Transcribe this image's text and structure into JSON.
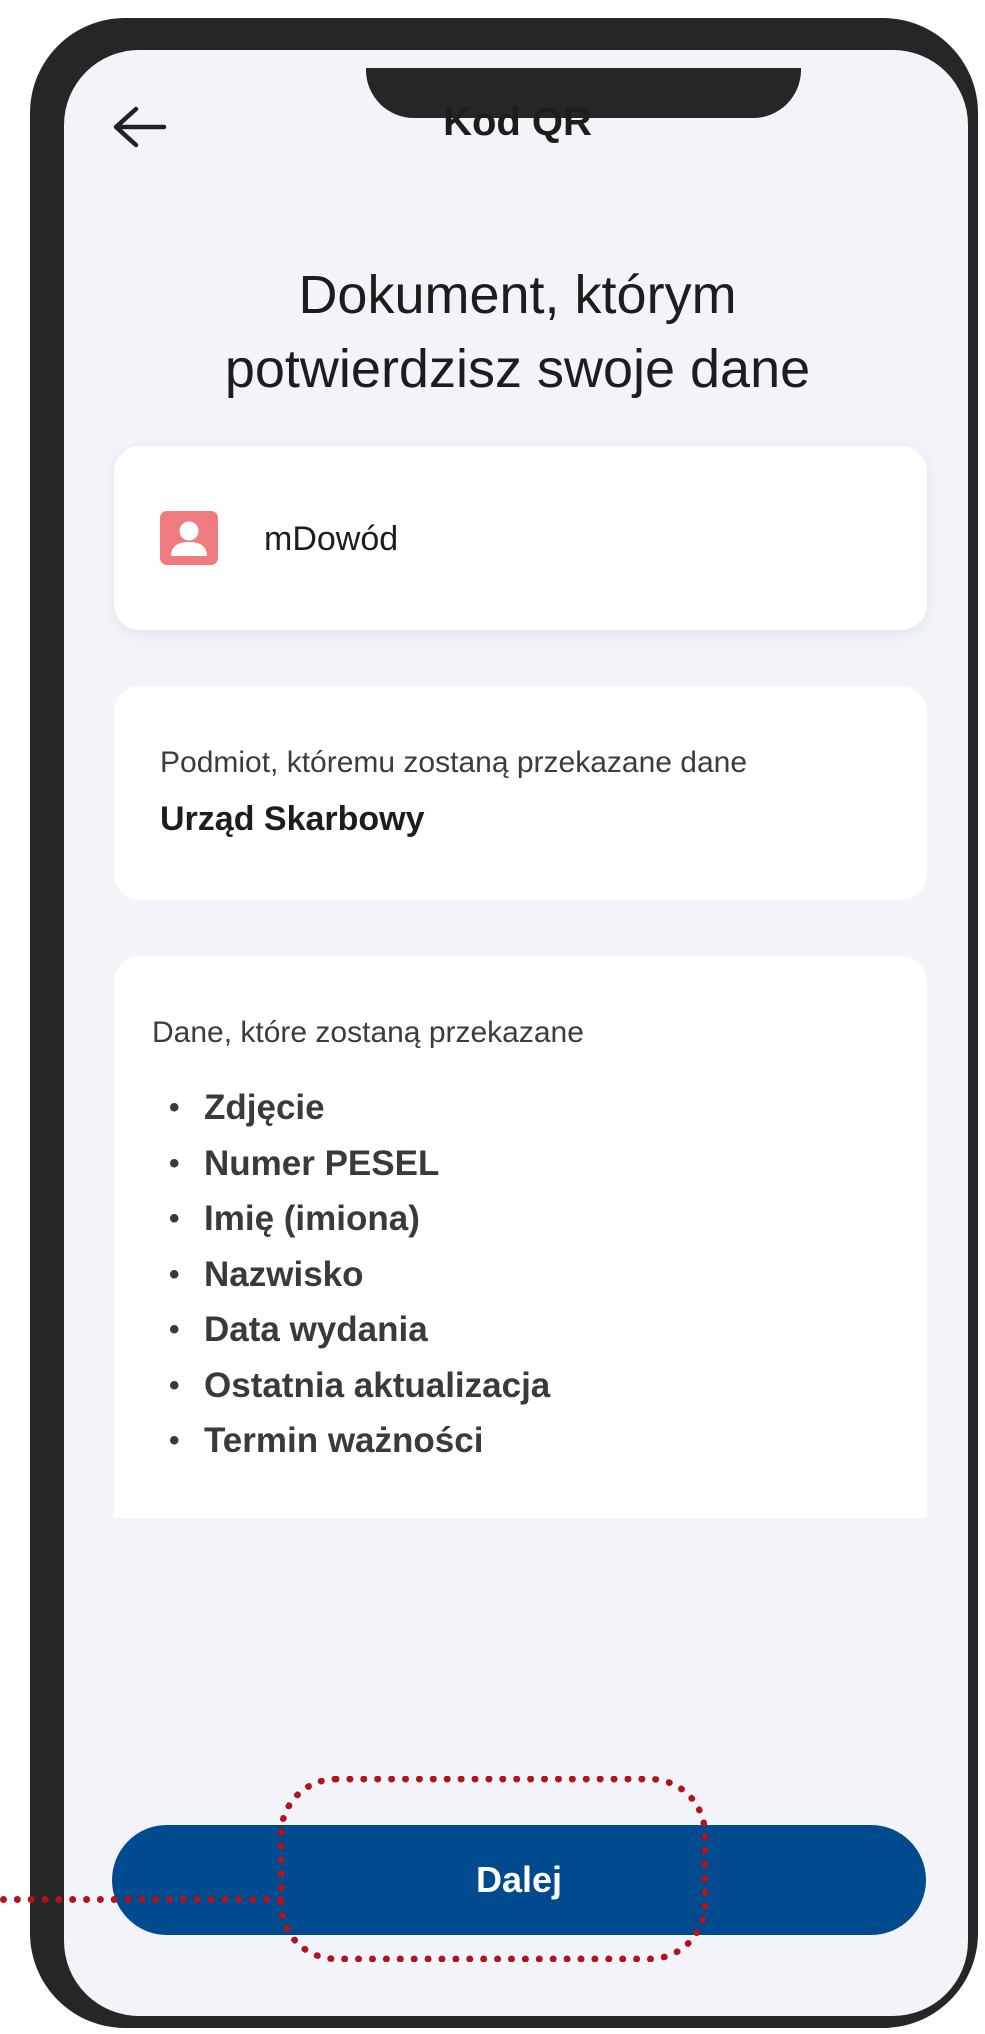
{
  "header": {
    "title": "Kod QR",
    "back_icon": "arrow-left-icon"
  },
  "heading": {
    "line1": "Dokument, którym",
    "line2": "potwierdzisz swoje dane"
  },
  "document_card": {
    "icon": "person-id-icon",
    "label": "mDowód",
    "icon_color": "#ef7a7f"
  },
  "entity_card": {
    "caption": "Podmiot, któremu zostaną przekazane dane",
    "name": "Urząd Skarbowy"
  },
  "data_card": {
    "caption": "Dane, które zostaną przekazane",
    "items": [
      "Zdjęcie",
      "Numer PESEL",
      "Imię (imiona)",
      "Nazwisko",
      "Data wydania",
      "Ostatnia aktualizacja",
      "Termin ważności"
    ]
  },
  "footer": {
    "next_label": "Dalej",
    "button_color": "#004a8f",
    "highlight_color": "#b0151b"
  }
}
